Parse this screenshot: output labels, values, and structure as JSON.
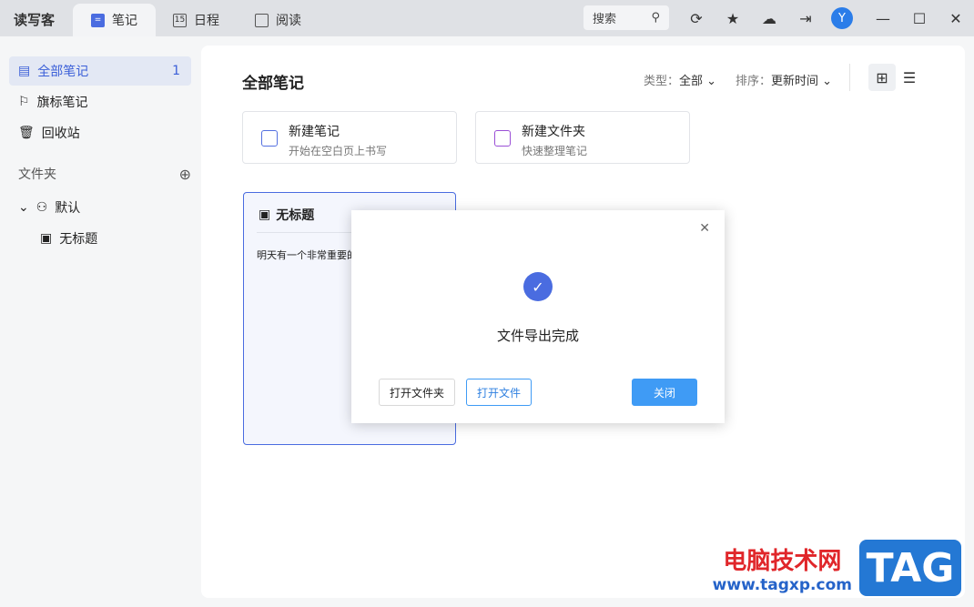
{
  "app": {
    "name": "读写客"
  },
  "tabs": [
    {
      "label": "笔记",
      "icon": "notes-icon"
    },
    {
      "label": "日程",
      "icon": "calendar-icon",
      "badge": "15"
    },
    {
      "label": "阅读",
      "icon": "book-icon"
    }
  ],
  "search": {
    "placeholder": "搜索"
  },
  "user": {
    "initial": "Y"
  },
  "sidebar": {
    "items": [
      {
        "label": "全部笔记",
        "count": "1"
      },
      {
        "label": "旗标笔记"
      },
      {
        "label": "回收站"
      }
    ],
    "folder_header": "文件夹",
    "folders": [
      {
        "label": "默认"
      }
    ],
    "notes": [
      {
        "label": "无标题"
      }
    ]
  },
  "main": {
    "title": "全部笔记",
    "filter_type_label": "类型：",
    "filter_type_value": "全部",
    "sort_label": "排序：",
    "sort_value": "更新时间",
    "create": [
      {
        "title": "新建笔记",
        "subtitle": "开始在空白页上书写"
      },
      {
        "title": "新建文件夹",
        "subtitle": "快速整理笔记"
      }
    ],
    "note": {
      "title": "无标题",
      "preview": "明天有一个非常重要的"
    }
  },
  "dialog": {
    "message": "文件导出完成",
    "open_folder": "打开文件夹",
    "open_file": "打开文件",
    "close": "关闭"
  },
  "watermark": {
    "site": "电脑技术网",
    "url": "www.tagxp.com",
    "logo": "TAG"
  },
  "colors": {
    "accent": "#4a6ce0",
    "button": "#3f9bf5"
  }
}
